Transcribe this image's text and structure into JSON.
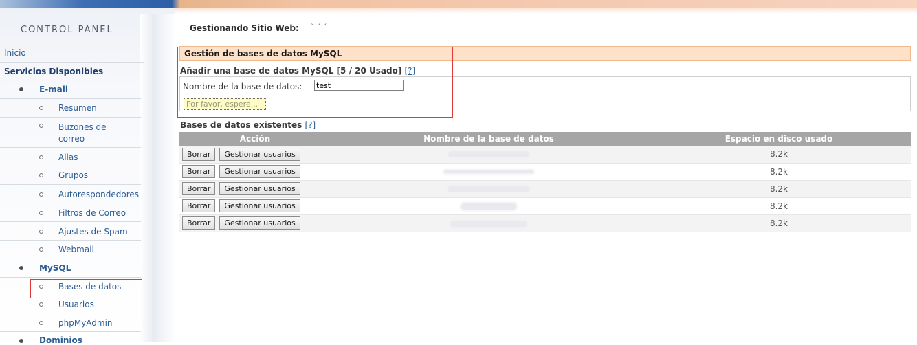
{
  "sidebar": {
    "title": "CONTROL PANEL",
    "inicio": "Inicio",
    "servicios": "Servicios Disponibles",
    "email": {
      "label": "E-mail",
      "items": [
        "Resumen",
        "Buzones de correo",
        "Alias",
        "Grupos",
        "Autorespondedores",
        "Filtros de Correo",
        "Ajustes de Spam",
        "Webmail"
      ]
    },
    "mysql": {
      "label": "MySQL",
      "items": [
        "Bases de datos",
        "Usuarios",
        "phpMyAdmin"
      ]
    },
    "dominios": "Dominios"
  },
  "main": {
    "site_label": "Gestionando Sitio Web:",
    "site_value": "` ´ ´",
    "section_title": "Gestión de bases de datos MySQL",
    "add_title": "Añadir una base de datos MySQL [5 / 20 Usado] ",
    "help": "[?]",
    "db_name_label": "Nombre de la base de datos:",
    "db_name_value": "test",
    "wait_button": "Por favor, espere...",
    "existing_title": "Bases de datos existentes ",
    "table": {
      "headers": [
        "Acción",
        "Nombre de la base de datos",
        "Espacio en disco usado"
      ],
      "delete_label": "Borrar",
      "manage_label": "Gestionar usuarios",
      "rows": [
        {
          "name": "",
          "disk": "8.2k"
        },
        {
          "name": "",
          "disk": "8.2k"
        },
        {
          "name": "",
          "disk": "8.2k"
        },
        {
          "name": "",
          "disk": "8.2k"
        },
        {
          "name": "",
          "disk": "8.2k"
        }
      ]
    }
  },
  "colors": {
    "link": "#2b5d95",
    "section_bar": "#fde2c9",
    "table_header": "#a6a6a6",
    "highlight": "#e23a3a"
  }
}
